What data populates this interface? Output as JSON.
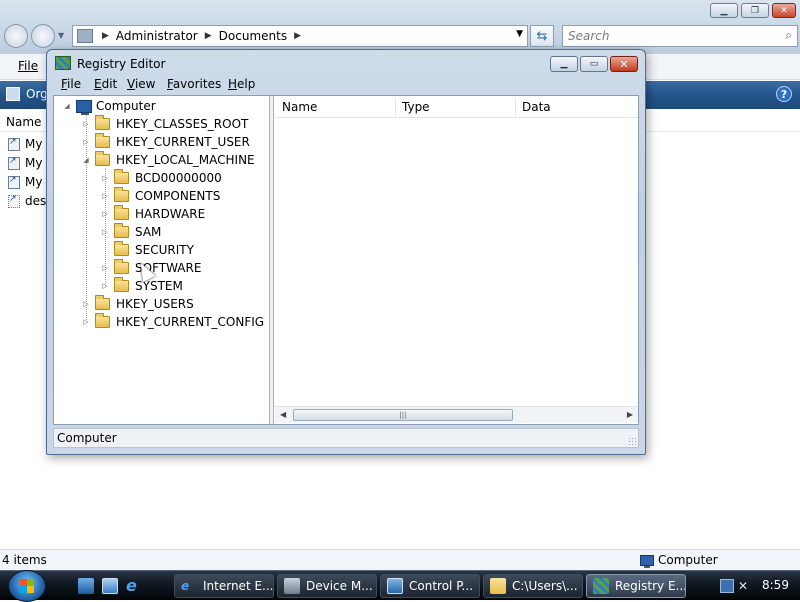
{
  "explorer": {
    "address_segments": [
      "Administrator",
      "Documents"
    ],
    "search_placeholder": "Search",
    "menu_file": "File",
    "organize_label": "Org",
    "help_glyph": "?",
    "column_name": "Name",
    "items": [
      "My",
      "My",
      "My",
      "desk"
    ],
    "status_count": "4 items",
    "status_location": "Computer"
  },
  "regedit": {
    "title": "Registry Editor",
    "menu": [
      "File",
      "Edit",
      "View",
      "Favorites",
      "Help"
    ],
    "tree": {
      "root": "Computer",
      "hives": [
        "HKEY_CLASSES_ROOT",
        "HKEY_CURRENT_USER",
        "HKEY_LOCAL_MACHINE"
      ],
      "hklm_children": [
        "BCD00000000",
        "COMPONENTS",
        "HARDWARE",
        "SAM",
        "SECURITY",
        "SOFTWARE",
        "SYSTEM"
      ],
      "hives_after": [
        "HKEY_USERS",
        "HKEY_CURRENT_CONFIG"
      ]
    },
    "columns": [
      "Name",
      "Type",
      "Data"
    ],
    "status": "Computer"
  },
  "taskbar": {
    "buttons": [
      "Internet E...",
      "Device M...",
      "Control P...",
      "C:\\Users\\...",
      "Registry E..."
    ],
    "clock": "8:59"
  },
  "colors": {
    "selection": "#3399ff",
    "toolbar_blue": "#25558a",
    "folder_yellow": "#e6bd4f"
  },
  "icons": [
    "search-icon",
    "refresh-icon",
    "folder-icon",
    "computer-icon",
    "regedit-icon",
    "windows-logo-icon",
    "help-icon"
  ]
}
